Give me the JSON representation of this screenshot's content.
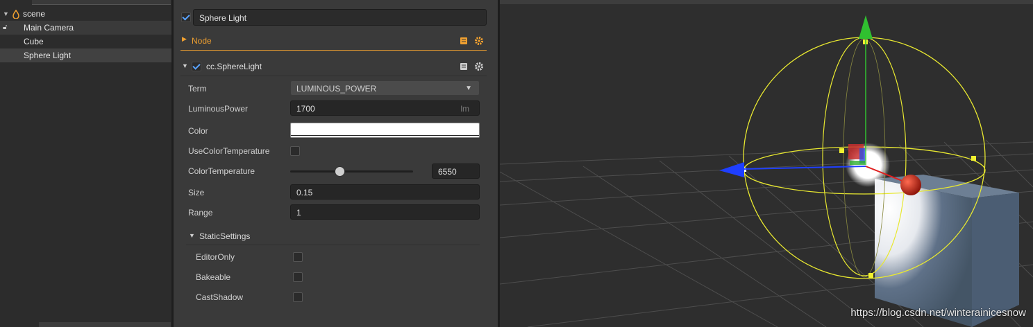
{
  "hierarchy": {
    "items": [
      {
        "label": "scene"
      },
      {
        "label": "Main Camera"
      },
      {
        "label": "Cube"
      },
      {
        "label": "Sphere Light"
      }
    ]
  },
  "inspector": {
    "node_name": "Sphere Light",
    "node_section": "Node",
    "component": {
      "name": "cc.SphereLight",
      "term_label": "Term",
      "term_value": "LUMINOUS_POWER",
      "luminous_power_label": "LuminousPower",
      "luminous_power_value": "1700",
      "luminous_power_unit": "lm",
      "color_label": "Color",
      "color_value": "#ffffff",
      "use_color_temp_label": "UseColorTemperature",
      "color_temp_label": "ColorTemperature",
      "color_temp_value": "6550",
      "color_temp_slider_fraction": 0.4,
      "size_label": "Size",
      "size_value": "0.15",
      "range_label": "Range",
      "range_value": "1",
      "static_settings_label": "StaticSettings",
      "editor_only_label": "EditorOnly",
      "bakeable_label": "Bakeable",
      "cast_shadow_label": "CastShadow"
    }
  },
  "scene": {
    "watermark": "https://blog.csdn.net/winterainicesnow"
  },
  "colors": {
    "accent_orange": "#f0a030",
    "checkbox_blue": "#59a3ff",
    "gizmo_yellow": "#e8e830",
    "axis_green": "#30c030",
    "axis_blue": "#1f3fff",
    "axis_red": "#e02020"
  }
}
